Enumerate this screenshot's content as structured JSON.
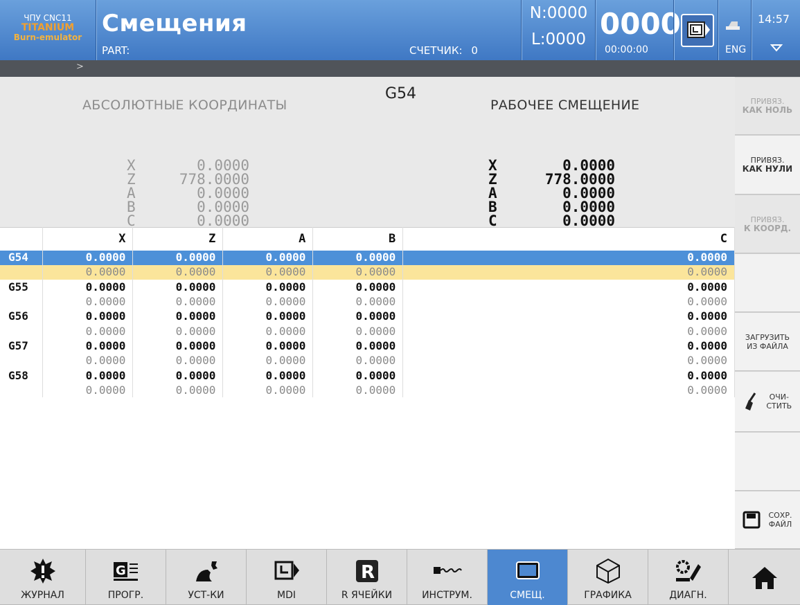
{
  "header": {
    "brand_line1": "ЧПУ CNC11",
    "brand_line2": "TITANIUM",
    "brand_line3": "Burn-emulator",
    "title": "Смещения",
    "part_label": "PART:",
    "counter_label": "СЧЕТЧИК:",
    "counter_value": "0",
    "n_value": "N:0000",
    "l_value": "L:0000",
    "big_value": "0000",
    "timer": "00:00:00",
    "lang": "ENG",
    "clock": "14:57"
  },
  "command_prompt": ">",
  "panel": {
    "abs_title": "АБСОЛЮТНЫЕ КООРДИНАТЫ",
    "g_code": "G54",
    "work_title": "РАБОЧЕЕ СМЕЩЕНИЕ",
    "axes": [
      "X",
      "Z",
      "A",
      "B",
      "C"
    ],
    "abs_values": [
      "0.0000",
      "778.0000",
      "0.0000",
      "0.0000",
      "0.0000"
    ],
    "work_values": [
      "0.0000",
      "778.0000",
      "0.0000",
      "0.0000",
      "0.0000"
    ]
  },
  "table": {
    "headers": [
      "",
      "X",
      "Z",
      "A",
      "B",
      "C"
    ],
    "rows": [
      {
        "name": "G54",
        "values": [
          "0.0000",
          "0.0000",
          "0.0000",
          "0.0000",
          "0.0000"
        ],
        "sub": [
          "0.0000",
          "0.0000",
          "0.0000",
          "0.0000",
          "0.0000"
        ]
      },
      {
        "name": "G55",
        "values": [
          "0.0000",
          "0.0000",
          "0.0000",
          "0.0000",
          "0.0000"
        ],
        "sub": [
          "0.0000",
          "0.0000",
          "0.0000",
          "0.0000",
          "0.0000"
        ]
      },
      {
        "name": "G56",
        "values": [
          "0.0000",
          "0.0000",
          "0.0000",
          "0.0000",
          "0.0000"
        ],
        "sub": [
          "0.0000",
          "0.0000",
          "0.0000",
          "0.0000",
          "0.0000"
        ]
      },
      {
        "name": "G57",
        "values": [
          "0.0000",
          "0.0000",
          "0.0000",
          "0.0000",
          "0.0000"
        ],
        "sub": [
          "0.0000",
          "0.0000",
          "0.0000",
          "0.0000",
          "0.0000"
        ]
      },
      {
        "name": "G58",
        "values": [
          "0.0000",
          "0.0000",
          "0.0000",
          "0.0000",
          "0.0000"
        ],
        "sub": [
          "0.0000",
          "0.0000",
          "0.0000",
          "0.0000",
          "0.0000"
        ]
      }
    ]
  },
  "side": {
    "b1_line1": "ПРИВЯЗ.",
    "b1_line2": "КАК НОЛЬ",
    "b2_line1": "ПРИВЯЗ.",
    "b2_line2": "КАК НУЛИ",
    "b3_line1": "ПРИВЯЗ.",
    "b3_line2": "К КООРД.",
    "load_line1": "ЗАГРУЗИТЬ",
    "load_line2": "ИЗ ФАЙЛА",
    "clear_line1": "ОЧИ-",
    "clear_line2": "СТИТЬ",
    "save_line1": "СОХР.",
    "save_line2": "ФАЙЛ"
  },
  "nav": [
    "ЖУРНАЛ",
    "ПРОГР.",
    "УСТ-КИ",
    "MDI",
    "R ЯЧЕЙКИ",
    "ИНСТРУМ.",
    "СМЕЩ.",
    "ГРАФИКА",
    "ДИАГН."
  ],
  "colors": {
    "header": "#4f86cc",
    "active": "#4d88d0",
    "selected_row": "#4d90d8",
    "highlight_row": "#fbe59b",
    "brand_orange": "#f0a030"
  }
}
